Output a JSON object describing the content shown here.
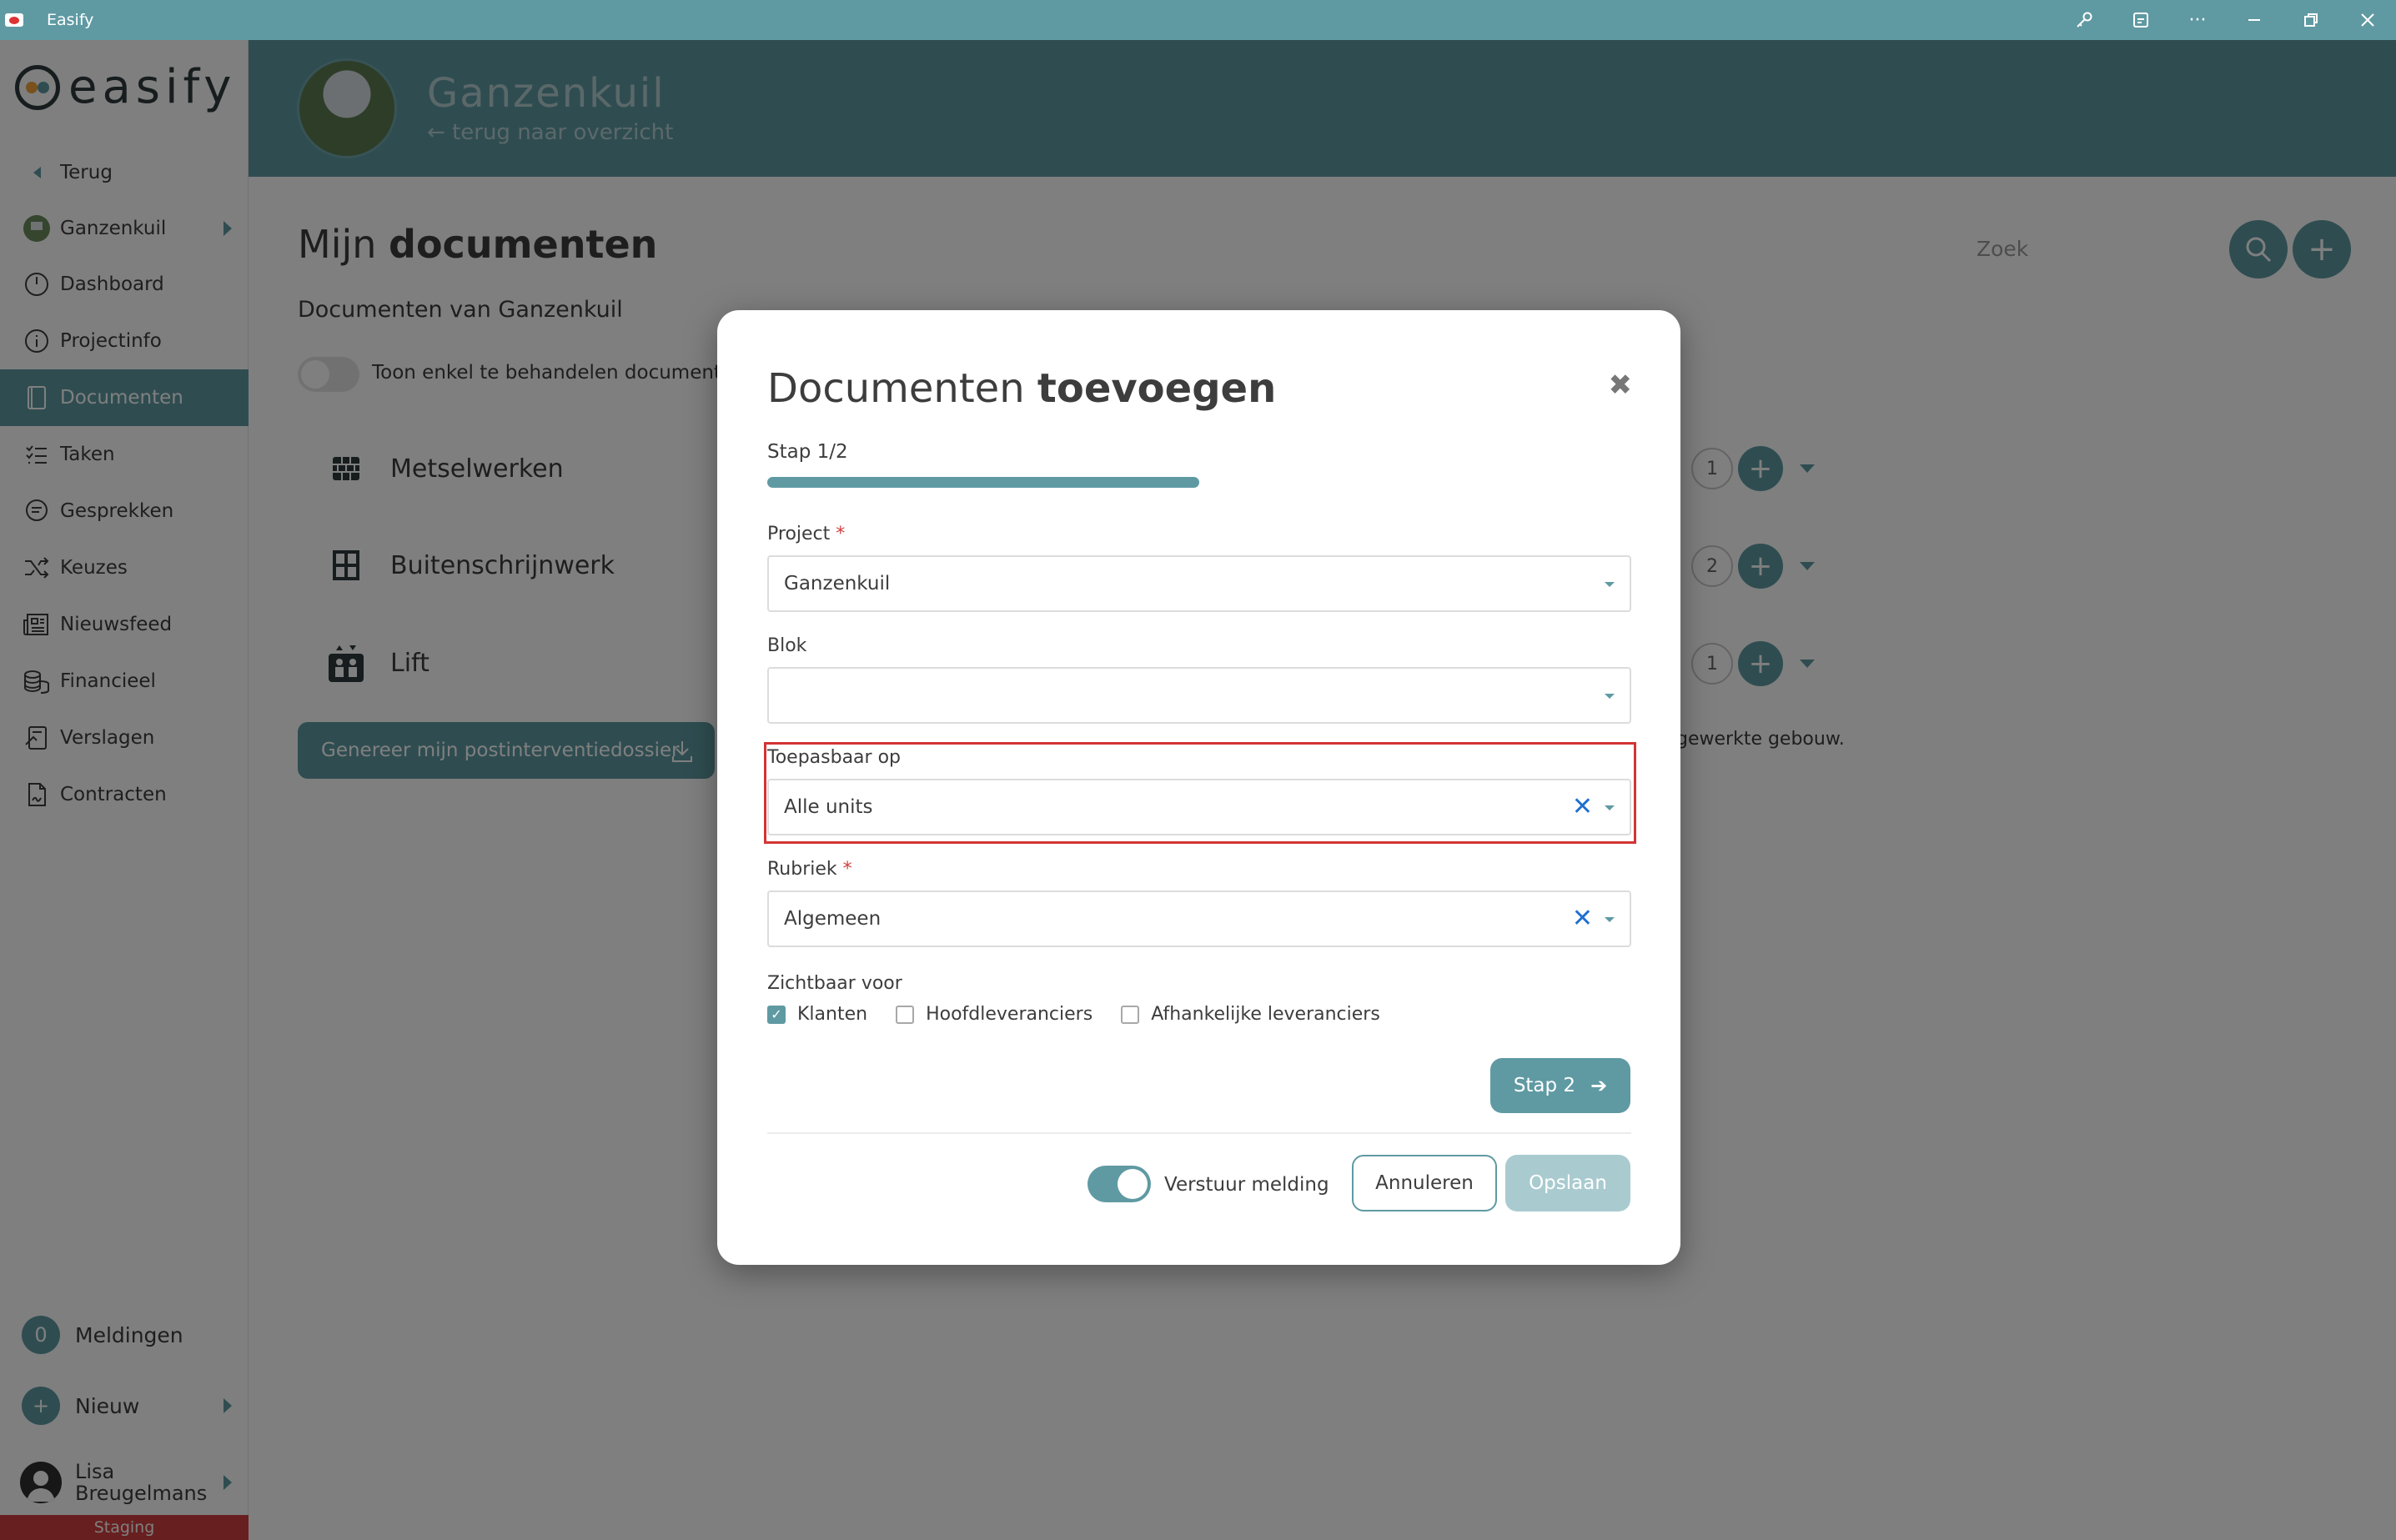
{
  "window": {
    "title": "Easify",
    "controls": [
      "key-icon",
      "cast-icon",
      "more-icon",
      "minimize-icon",
      "restore-icon",
      "close-icon"
    ]
  },
  "sidebar": {
    "logo_text": "easify",
    "back_label": "Terug",
    "project_label": "Ganzenkuil",
    "items": [
      {
        "label": "Dashboard",
        "icon": "dashboard-icon"
      },
      {
        "label": "Projectinfo",
        "icon": "info-icon"
      },
      {
        "label": "Documenten",
        "icon": "document-icon",
        "active": true
      },
      {
        "label": "Taken",
        "icon": "tasks-icon"
      },
      {
        "label": "Gesprekken",
        "icon": "chat-icon"
      },
      {
        "label": "Keuzes",
        "icon": "shuffle-icon"
      },
      {
        "label": "Nieuwsfeed",
        "icon": "newspaper-icon"
      },
      {
        "label": "Financieel",
        "icon": "coins-icon"
      },
      {
        "label": "Verslagen",
        "icon": "report-icon"
      },
      {
        "label": "Contracten",
        "icon": "contract-icon"
      }
    ],
    "notifications": {
      "count": "0",
      "label": "Meldingen"
    },
    "new_label": "Nieuw",
    "user_first": "Lisa",
    "user_last": "Breugelmans",
    "env_label": "Staging"
  },
  "header": {
    "project_name": "Ganzenkuil",
    "back_link": "terug naar overzicht"
  },
  "main": {
    "title_light": "Mijn",
    "title_bold": "documenten",
    "subtitle": "Documenten van Ganzenkuil",
    "toggle_label": "Toon enkel te behandelen documenten",
    "search_label": "Zoek",
    "categories": [
      {
        "name": "Metselwerken",
        "count": "1",
        "icon": "brick-wall-icon"
      },
      {
        "name": "Buitenschrijnwerk",
        "count": "2",
        "icon": "window-icon"
      },
      {
        "name": "Lift",
        "count": "1",
        "icon": "elevator-icon"
      }
    ],
    "generate_button": "Genereer mijn postinterventiedossier",
    "side_note": "gewerkte gebouw."
  },
  "modal": {
    "title_light": "Documenten",
    "title_bold": "toevoegen",
    "step_label": "Stap 1/2",
    "progress": 0.5,
    "fields": {
      "project": {
        "label": "Project",
        "value": "Ganzenkuil",
        "required": "*"
      },
      "blok": {
        "label": "Blok",
        "value": ""
      },
      "toepasbaar": {
        "label": "Toepasbaar op",
        "value": "Alle units"
      },
      "rubriek": {
        "label": "Rubriek",
        "value": "Algemeen",
        "required": "*"
      }
    },
    "visibility": {
      "label": "Zichtbaar voor",
      "options": [
        {
          "label": "Klanten",
          "checked": true
        },
        {
          "label": "Hoofdleveranciers",
          "checked": false
        },
        {
          "label": "Afhankelijke leveranciers",
          "checked": false
        }
      ]
    },
    "step2_button": "Stap 2",
    "notify_label": "Verstuur melding",
    "cancel_button": "Annuleren",
    "save_button": "Opslaan"
  },
  "colors": {
    "accent": "#5f9aa3",
    "danger": "#d13f3f",
    "clear_x": "#1f6fd1"
  }
}
